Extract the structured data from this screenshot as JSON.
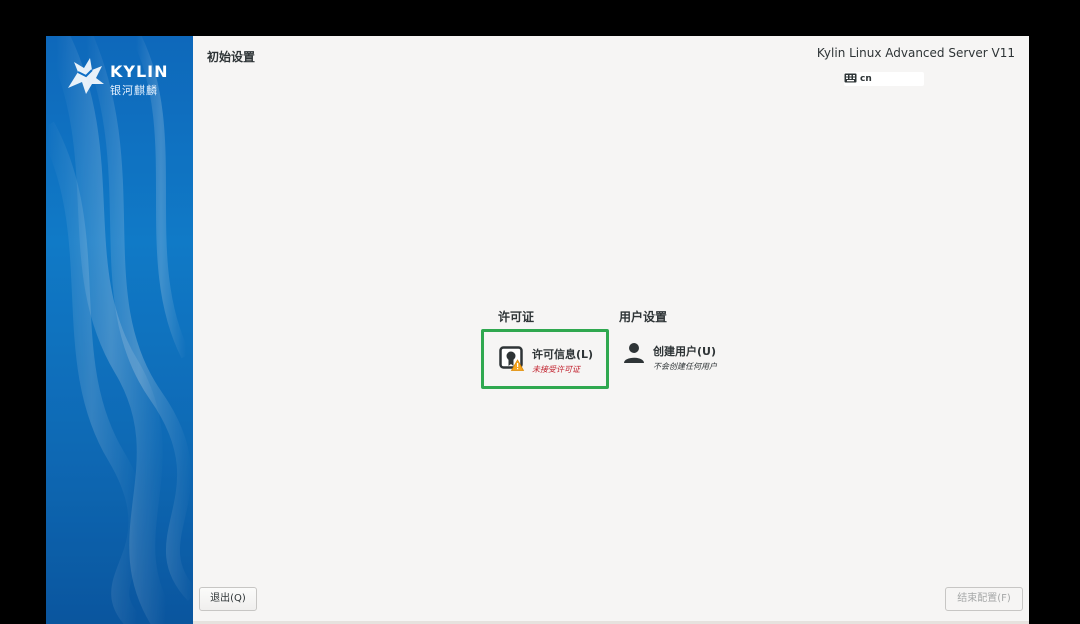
{
  "sidebar": {
    "logo": {
      "latin": "KYLIN",
      "cjk": "银河麒麟"
    }
  },
  "header": {
    "title": "初始设置",
    "product": "Kylin Linux Advanced Server V11",
    "keyboard_layout": "cn",
    "keyboard_icon": "keyboard-icon"
  },
  "categories": [
    {
      "title": "许可证",
      "spokes": [
        {
          "name": "许可信息(L)",
          "status": "未接受许可证",
          "icon": "license-warning-icon",
          "status_color": "#c01c28"
        }
      ]
    },
    {
      "title": "用户设置",
      "spokes": [
        {
          "name": "创建用户(U)",
          "status": "不会创建任何用户",
          "icon": "user-icon",
          "status_color": "#2e3436"
        }
      ]
    }
  ],
  "buttons": {
    "quit": "退出(Q)",
    "finish": "结束配置(F)"
  },
  "colors": {
    "highlight": "#2fa84f",
    "warning": "#f5a623"
  }
}
